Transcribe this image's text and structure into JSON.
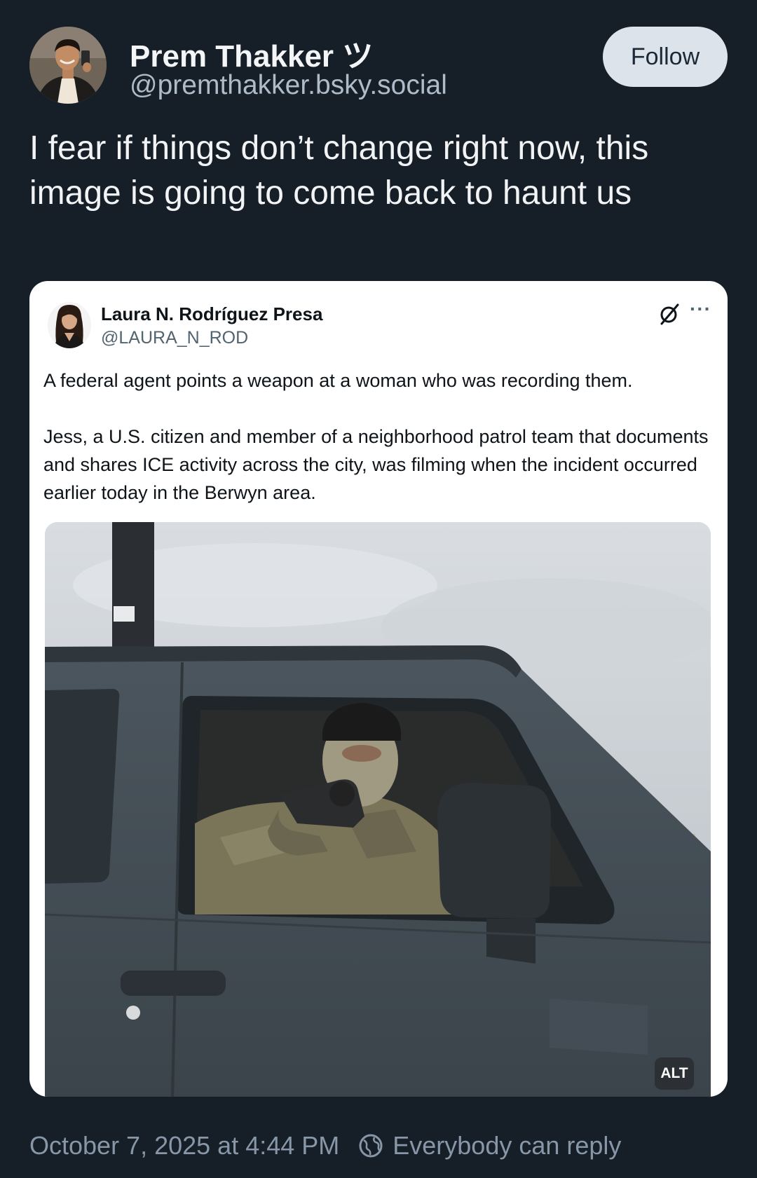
{
  "post": {
    "author_name": "Prem Thakker ツ",
    "author_handle": "@premthakker.bsky.social",
    "follow_label": "Follow",
    "text": "I fear if things don’t change right now, this image is going to come back to haunt us",
    "timestamp": "October 7, 2025 at 4:44 PM",
    "reply_setting": "Everybody can reply"
  },
  "embed": {
    "author_name": "Laura N. Rodríguez Presa",
    "author_handle": "@LAURA_N_ROD",
    "more_label": "···",
    "paragraph_1": "A federal agent points a weapon at a woman who was recording them.",
    "paragraph_2": "Jess, a U.S. citizen and member of a neighborhood patrol team that documents and shares ICE activity across the city, was filming when the incident occurred earlier today in the Berwyn area.",
    "photo_alt_badge": "ALT"
  },
  "icons": {
    "embed_action": "grok-icon",
    "reply_setting": "globe-icon"
  },
  "colors": {
    "background": "#161e27",
    "follow_button_bg": "#dde3ea",
    "muted_text": "#8797a7",
    "handle_text": "#aebbc9"
  }
}
